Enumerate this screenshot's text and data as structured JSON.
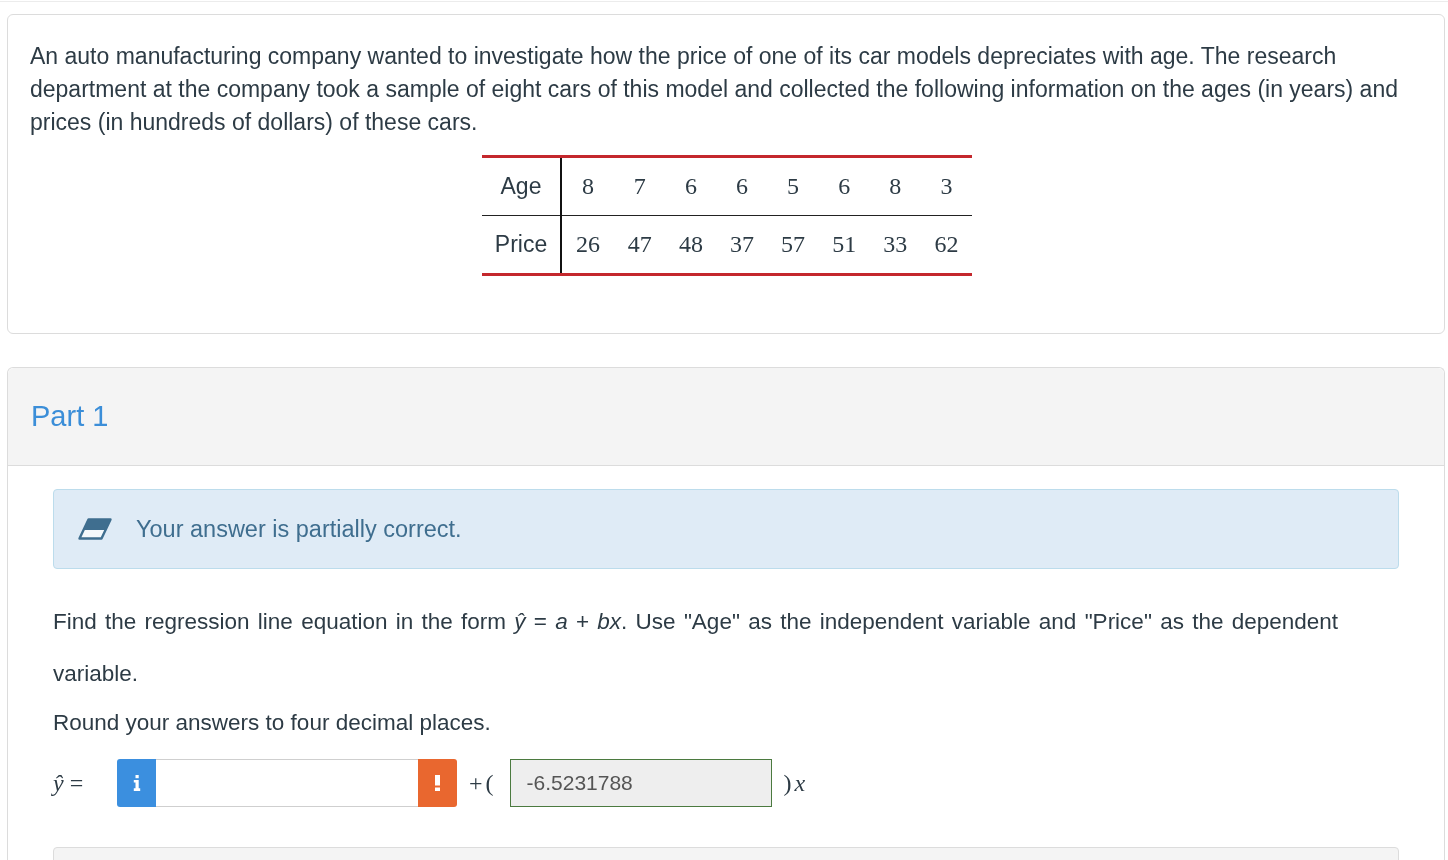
{
  "problem": {
    "text": "An auto manufacturing company wanted to investigate how the price of one of its car models depreciates with age. The research department at the company took a sample of eight cars of this model and collected the following information on the ages (in years) and prices (in hundreds of dollars) of these cars.",
    "table": {
      "rows": [
        {
          "label": "Age",
          "values": [
            "8",
            "7",
            "6",
            "6",
            "5",
            "6",
            "8",
            "3"
          ]
        },
        {
          "label": "Price",
          "values": [
            "26",
            "47",
            "48",
            "37",
            "57",
            "51",
            "33",
            "62"
          ]
        }
      ]
    }
  },
  "part": {
    "title": "Part 1",
    "feedback": {
      "kind": "partial",
      "text": "Your answer is partially correct."
    },
    "question": "Find the regression line equation in the form *ŷ* = *a* + *bx*. Use \"Age\" as the independent variable and \"Price\" as the dependent variable.",
    "instruction": "Round your answers to four decimal places.",
    "answer": {
      "prefix": "*ŷ* =",
      "fields": [
        {
          "info": true,
          "correct": false,
          "suffix": "+("
        },
        {
          "value": "-6.5231788",
          "info": false,
          "correct": true,
          "suffix": ")*x*"
        }
      ]
    }
  }
}
